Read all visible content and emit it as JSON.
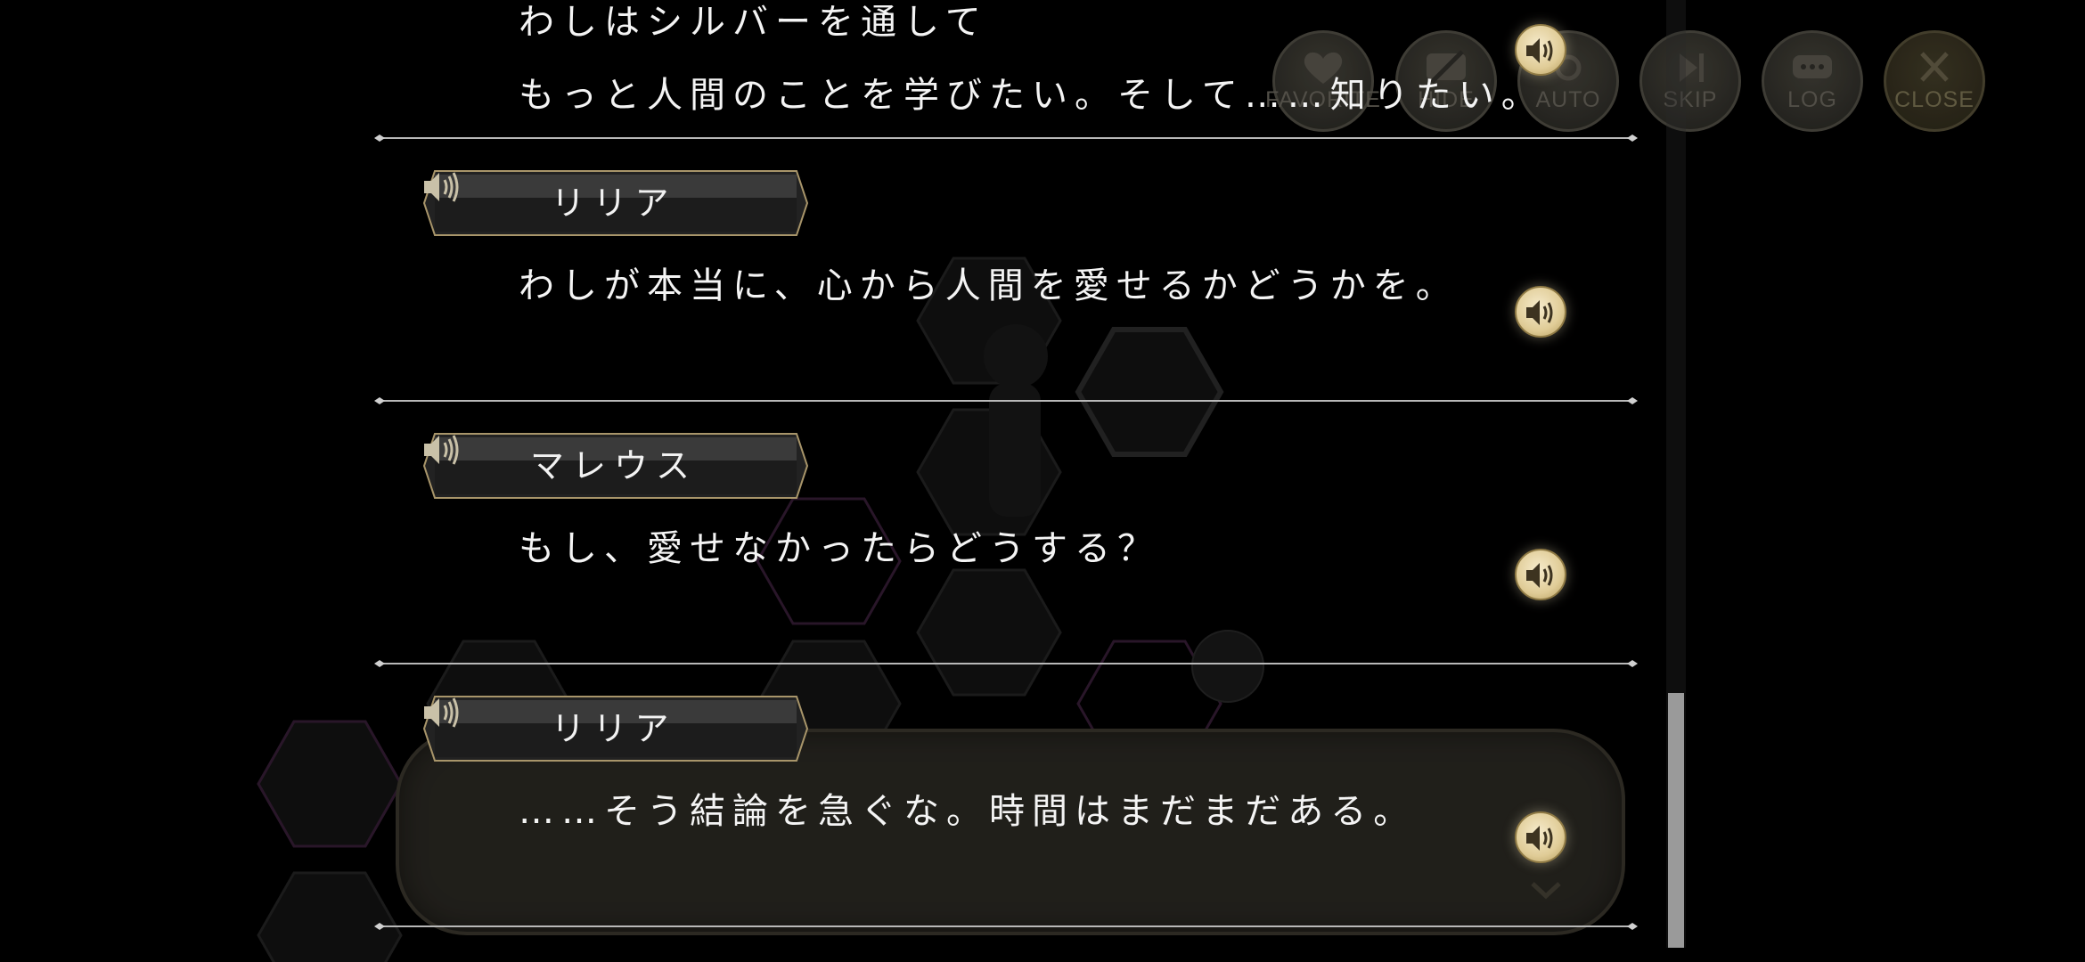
{
  "hud": {
    "buttons": [
      {
        "id": "favorite",
        "label": "FAVORITE",
        "icon": "heart-icon"
      },
      {
        "id": "hide",
        "label": "HIDE",
        "icon": "hide-icon"
      },
      {
        "id": "auto",
        "label": "AUTO",
        "icon": "auto-icon"
      },
      {
        "id": "skip",
        "label": "SKIP",
        "icon": "skip-icon"
      },
      {
        "id": "log",
        "label": "LOG",
        "icon": "chat-bubble-icon"
      },
      {
        "id": "close",
        "label": "CLOSE",
        "icon": "close-icon"
      }
    ]
  },
  "log": {
    "entries": [
      {
        "speaker": "",
        "lines": [
          "わしはシルバーを通して",
          "もっと人間のことを学びたい。そして……知りたい。"
        ]
      },
      {
        "speaker": "リリア",
        "lines": [
          "わしが本当に、心から人間を愛せるかどうかを。"
        ]
      },
      {
        "speaker": "マレウス",
        "lines": [
          "もし、愛せなかったらどうする？"
        ]
      },
      {
        "speaker": "リリア",
        "lines": [
          "……そう結論を急ぐな。時間はまだまだある。"
        ]
      }
    ]
  },
  "colors": {
    "accent_gold": "#d9c48f",
    "namebar_border": "#a8956a",
    "text": "#f4f4f4",
    "divider": "#b8b8b8",
    "scrollbar": "#9a9a9a"
  }
}
